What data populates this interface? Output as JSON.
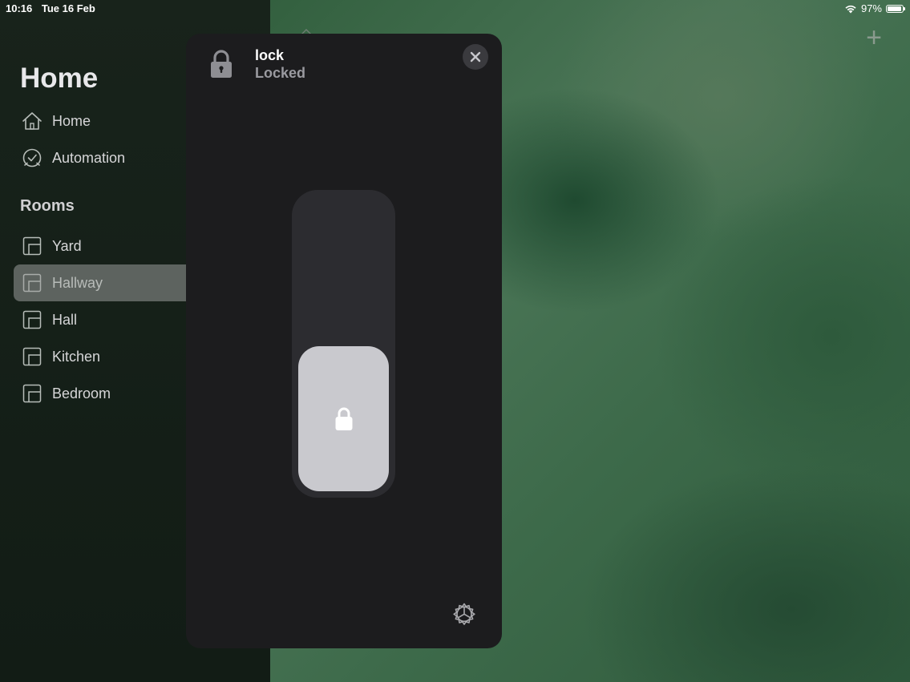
{
  "status_bar": {
    "time": "10:16",
    "date": "Tue 16 Feb",
    "battery_percent": "97%",
    "battery_level": 0.97
  },
  "sidebar": {
    "title": "Home",
    "nav_items": [
      {
        "label": "Home",
        "icon": "house-icon"
      },
      {
        "label": "Automation",
        "icon": "clock-check-icon"
      }
    ],
    "rooms_title": "Rooms",
    "rooms": [
      {
        "label": "Yard",
        "icon": "room-icon",
        "selected": false
      },
      {
        "label": "Hallway",
        "icon": "room-icon",
        "selected": true
      },
      {
        "label": "Hall",
        "icon": "room-icon",
        "selected": false
      },
      {
        "label": "Kitchen",
        "icon": "room-icon",
        "selected": false
      },
      {
        "label": "Bedroom",
        "icon": "room-icon",
        "selected": false
      }
    ]
  },
  "toolbar": {
    "add_label": "+"
  },
  "accessory_card": {
    "title": "lock",
    "status": "Locked",
    "state": "locked",
    "icon": "padlock-icon"
  },
  "colors": {
    "card_background": "#1c1c1e",
    "sidebar_selected": "#5d635f",
    "lock_thumb": "#c9c9ce",
    "lock_track": "#2c2c30"
  }
}
